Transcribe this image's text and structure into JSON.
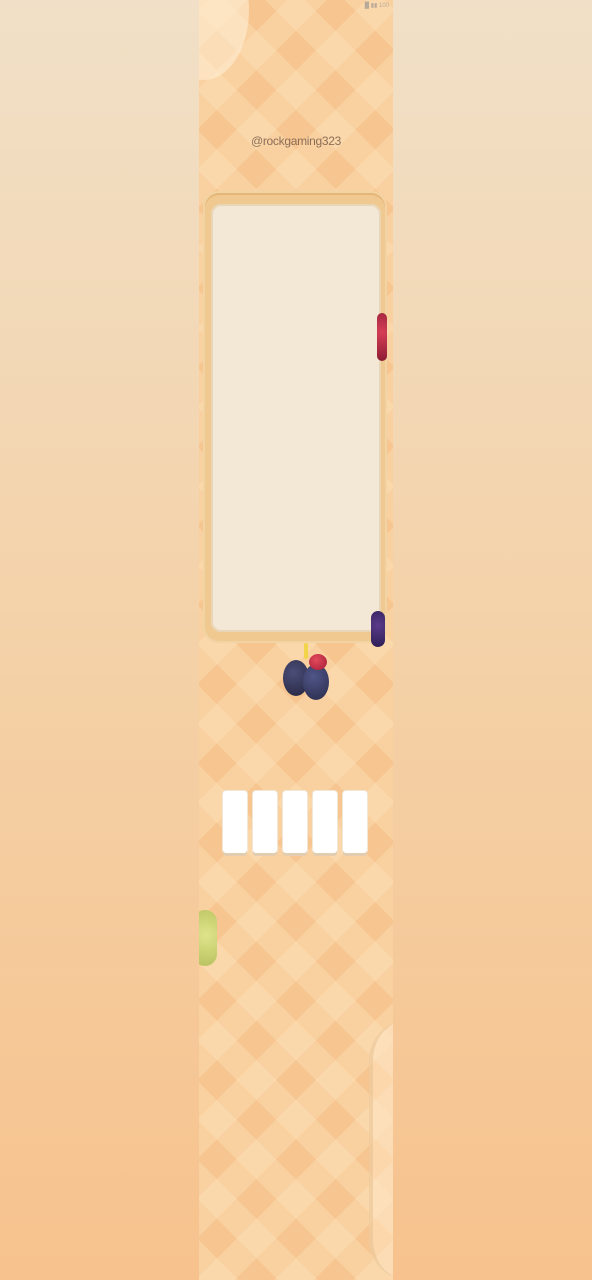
{
  "status_bar": {
    "text": "█ ▮▮ 100"
  },
  "player": {
    "handle": "@rockgaming323"
  },
  "board": {
    "state": "empty"
  },
  "tray": {
    "slot_count": 5,
    "slots": [
      "",
      "",
      "",
      "",
      ""
    ]
  },
  "fruits": [
    {
      "icon": "plum-icon"
    },
    {
      "icon": "plum-icon"
    },
    {
      "icon": "strawberry-icon"
    },
    {
      "icon": "raspberry-icon"
    },
    {
      "icon": "grape-icon"
    },
    {
      "icon": "pear-icon"
    }
  ],
  "colors": {
    "background": "#f7c690",
    "board": "#f3e8d6",
    "board_frame": "#f0c991",
    "slot": "#ffffff"
  }
}
